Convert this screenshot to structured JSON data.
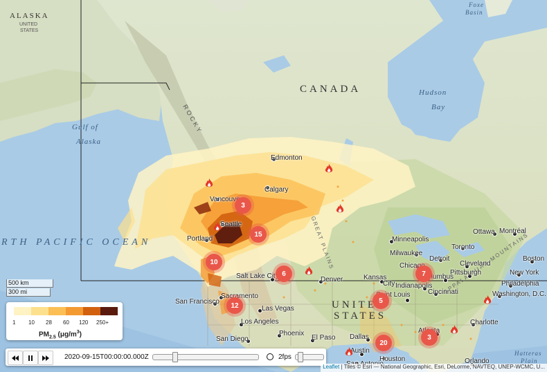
{
  "legend": {
    "ticks": [
      "1",
      "10",
      "28",
      "60",
      "120",
      "250+"
    ],
    "colors": [
      "#fff3c4",
      "#fde08d",
      "#fbbf55",
      "#f49a32",
      "#d2610f",
      "#8c2a0c",
      "#5a1a0e"
    ],
    "unit_base": "PM",
    "unit_sub": "2.5",
    "unit_rest": " (μg/m",
    "unit_sup": "3",
    "unit_end": ")"
  },
  "scale": {
    "km": "500 km",
    "mi": "300 mi"
  },
  "controls": {
    "timestamp": "2020-09-15T00:00:00.000Z",
    "fps": "2fps",
    "rewind_icon": "rewind-icon",
    "pause_icon": "pause-icon",
    "forward_icon": "forward-icon",
    "clock_icon": "clock-icon"
  },
  "attribution": {
    "leaflet": "Leaflet",
    "rest": " | Tiles © Esri — National Geographic, Esri, DeLorme, NAVTEQ, UNEP-WCMC, U..."
  },
  "labels": {
    "alaska": "ALASKA",
    "alaska_sub": "UNITED",
    "alaska_sub2": "STATES",
    "canada": "CANADA",
    "us1": "UNITED",
    "us2": "STATES",
    "gulf1": "Gulf of",
    "gulf2": "Alaska",
    "hudson1": "Hudson",
    "hudson2": "Bay",
    "foxe1": "Foxe",
    "foxe2": "Basin",
    "pacific": "RTH PACIFIC OCEAN",
    "rocky": "ROCKY",
    "appalachian": "APPALACHIAN MOUNTAINS",
    "hatteras1": "Hatteras",
    "hatteras2": "Plain",
    "plains": "GREAT PLAINS"
  },
  "cities": [
    "Edmonton",
    "Calgary",
    "Vancouver",
    "Seattle",
    "Portland",
    "Sacramento",
    "San Francisco",
    "Las Vegas",
    "Los Angeles",
    "San Diego",
    "Phoenix",
    "Salt Lake City",
    "Denver",
    "El Paso",
    "Dallas",
    "Austin",
    "San Antonio",
    "Houston",
    "Minneapolis",
    "Milwaukee",
    "Chicago",
    "Detroit",
    "Toronto",
    "Ottawa",
    "Montréal",
    "Cleveland",
    "Pittsburgh",
    "Boston",
    "New York",
    "Philadelphia",
    "Washington, D.C.",
    "Charlotte",
    "Atlanta",
    "Orlando",
    "Kansas",
    "City",
    "Saint Louis",
    "Indianapolis",
    "Cincinnati",
    "Columbus"
  ],
  "clusters": [
    "3",
    "15",
    "10",
    "6",
    "12",
    "5",
    "7",
    "20",
    "3"
  ],
  "fire_icon": "fire-icon"
}
